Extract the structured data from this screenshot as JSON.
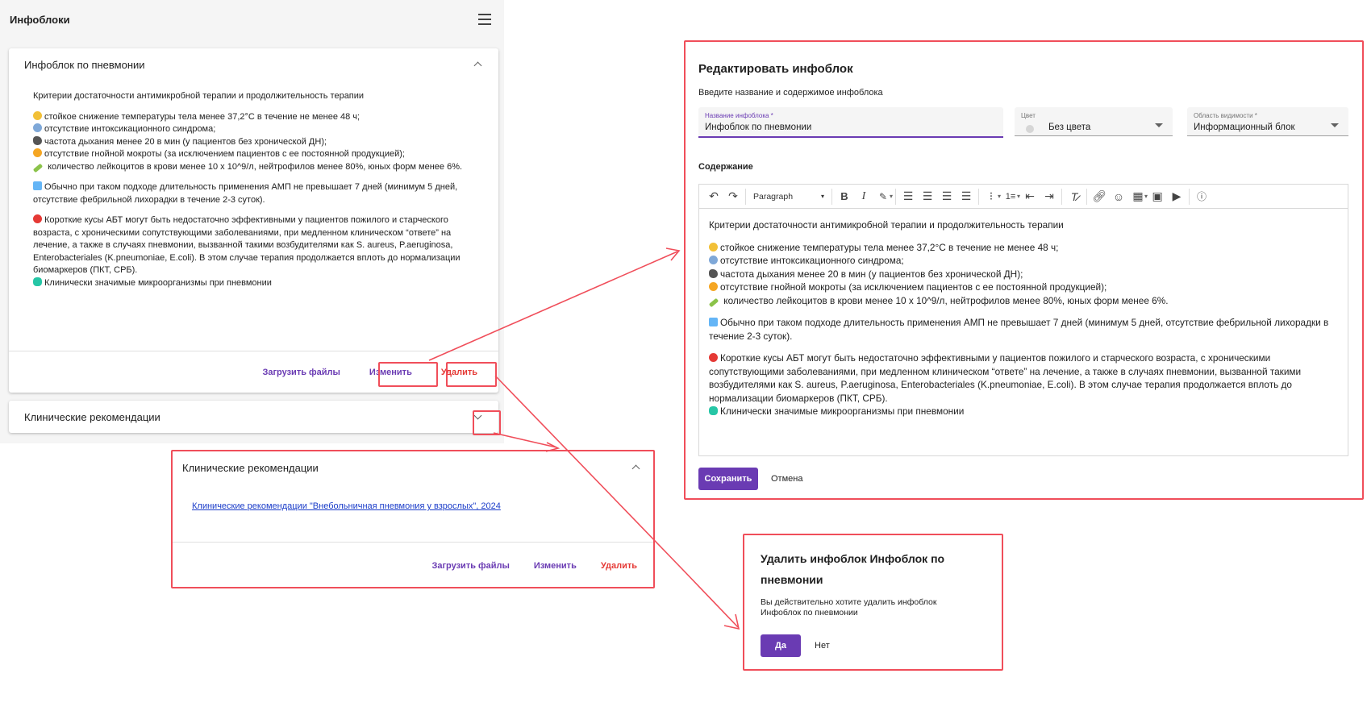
{
  "left_panel": {
    "title": "Инфоблоки"
  },
  "card_pneumonia": {
    "title": "Инфоблок по пневмонии",
    "lines": [
      "Критерии достаточности антимикробной терапии и продолжительность терапии",
      "стойкое снижение температуры тела менее 37,2°С в течение не менее 48 ч;",
      "отсутствие интоксикационного синдрома;",
      "частота дыхания менее 20 в мин (у пациентов без хронической ДН);",
      "отсутствие гнойной мокроты (за исключением пациентов с ее постоянной продукцией);",
      "количество лейкоцитов в крови менее 10 х 10^9/л, нейтрофилов менее 80%, юных форм менее 6%.",
      "Обычно при таком подходе длительность применения АМП не превышает 7 дней (минимум 5 дней, отсутствие фебрильной лихорадки в течение 2-3 суток).",
      "Короткие кусы АБТ могут быть недостаточно эффективными у пациентов пожилого и старческого возраста, с хроническими сопутствующими заболеваниями, при медленном клиническом “ответе” на лечение, а также в случаях пневмонии, вызванной такими возбудителями как S. aureus, P.aeruginosa, Enterobacteriales (K.pneumoniae, E.coli). В этом случае терапия продолжается вплоть до нормализации биомаркеров (ПКТ, СРБ).",
      "Клинически значимые микроорганизмы при пневмонии"
    ],
    "upload_label": "Загрузить файлы",
    "edit_label": "Изменить",
    "delete_label": "Удалить"
  },
  "card_recs_collapsed": {
    "title": "Клинические рекомендации"
  },
  "card_recs_expanded": {
    "title": "Клинические рекомендации",
    "link_text": "Клинические рекомендации \"Внебольничная пневмония у взрослых\", 2024",
    "upload_label": "Загрузить файлы",
    "edit_label": "Изменить",
    "delete_label": "Удалить"
  },
  "edit_dialog": {
    "title": "Редактировать инфоблок",
    "subtitle": "Введите название и содержимое инфоблока",
    "name_field": {
      "label": "Название инфоблока *",
      "value": "Инфоблок по пневмонии"
    },
    "color_field": {
      "label": "Цвет",
      "value": "Без цвета"
    },
    "scope_field": {
      "label": "Область видимости *",
      "value": "Информационный блок"
    },
    "content_label": "Содержание",
    "toolbar": {
      "format_select": "Paragraph"
    },
    "save_label": "Сохранить",
    "cancel_label": "Отмена"
  },
  "delete_dialog": {
    "title": "Удалить инфоблок Инфоблок по пневмонии",
    "text": "Вы действительно хотите удалить инфоблок Инфоблок по пневмонии",
    "yes_label": "Да",
    "no_label": "Нет"
  },
  "colors": {
    "accent": "#6a3bb3",
    "danger": "#e53935",
    "highlight": "#f04e5a",
    "link": "#1a3cc9"
  }
}
